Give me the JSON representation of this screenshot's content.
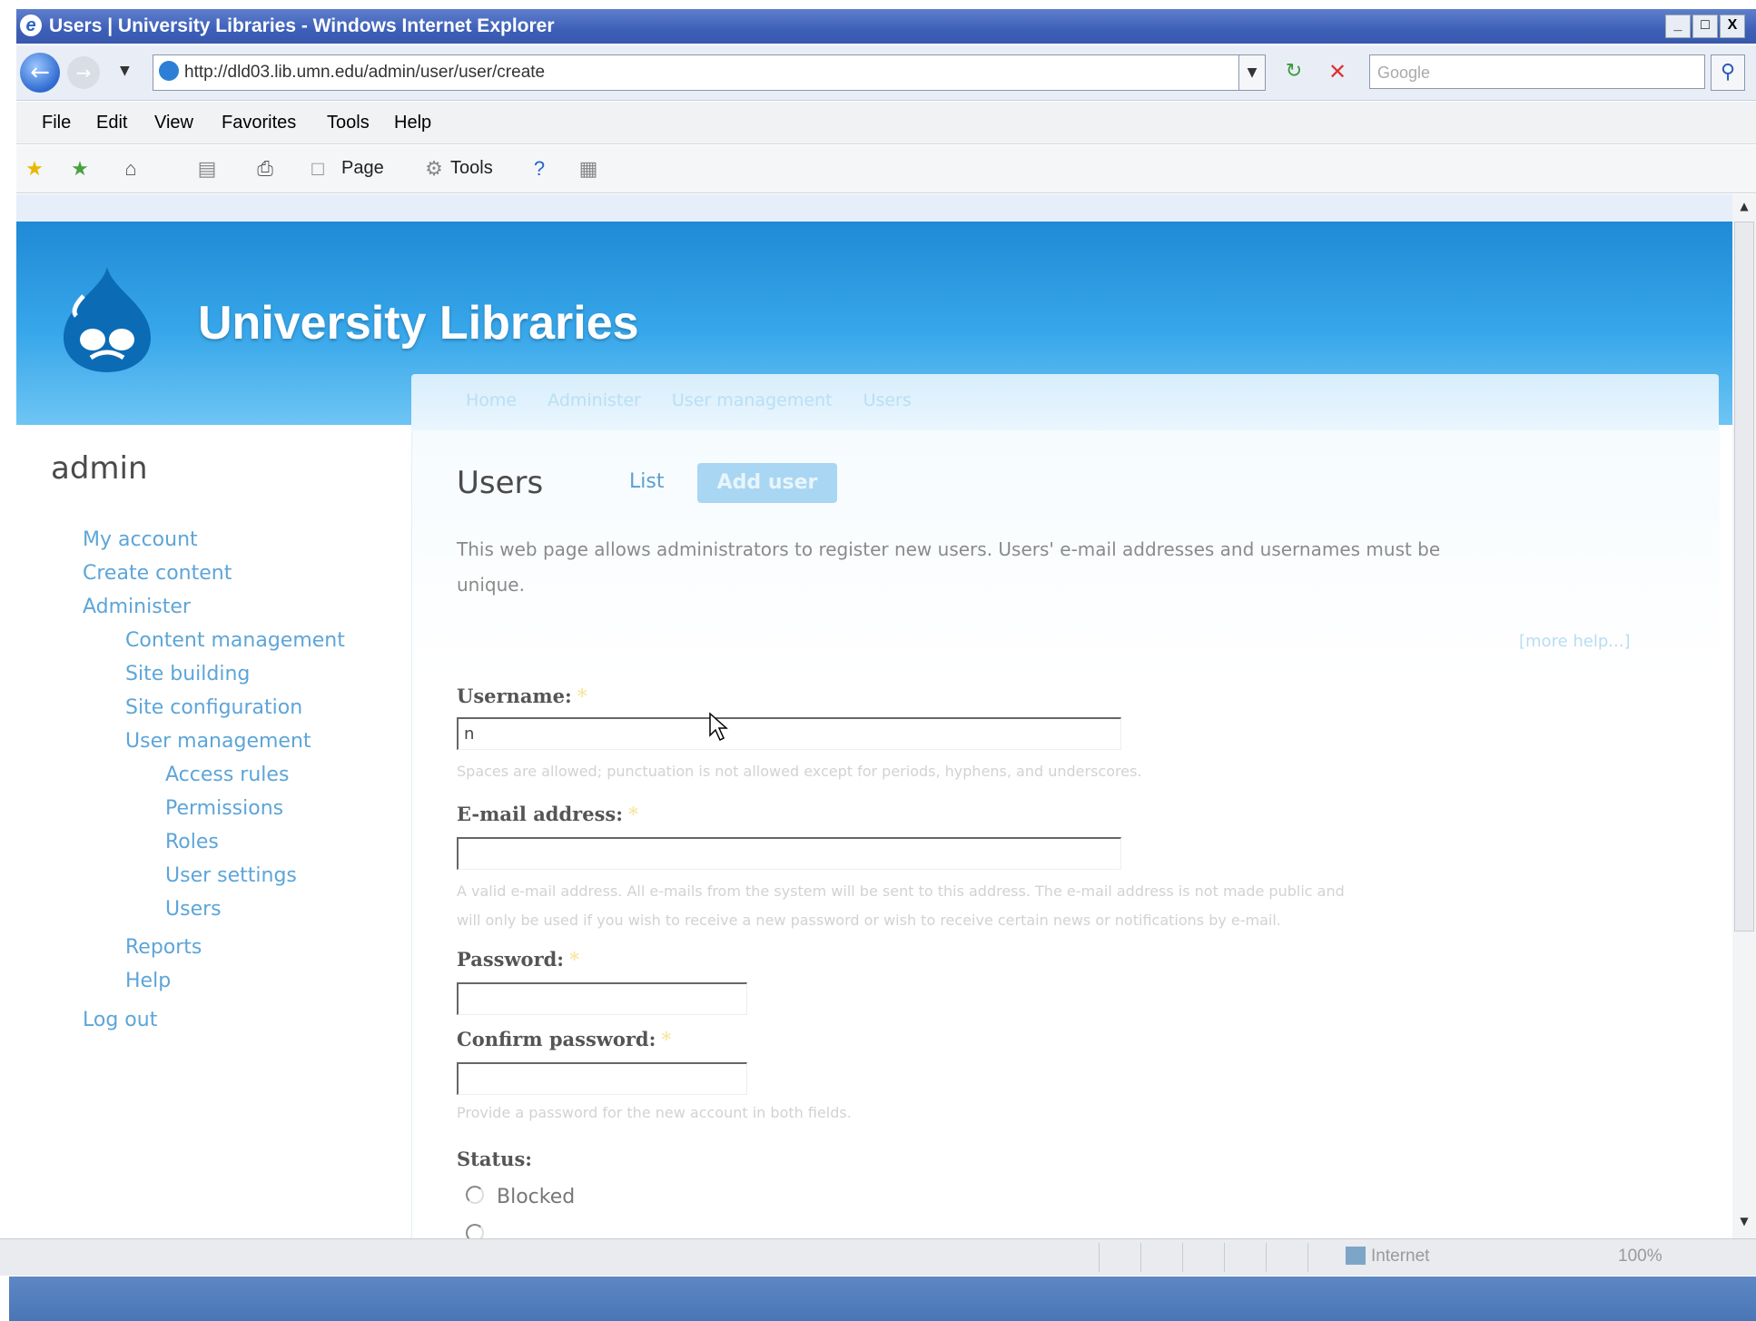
{
  "window": {
    "title": "Users | University Libraries - Windows Internet Explorer",
    "controls": {
      "minimize": "_",
      "maximize": "□",
      "close": "X"
    }
  },
  "addressbar": {
    "url": "http://dld03.lib.umn.edu/admin/user/user/create",
    "search_placeholder": "Google",
    "icons": [
      "back-icon",
      "forward-icon",
      "refresh-icon",
      "stop-icon",
      "search-icon"
    ]
  },
  "menubar": {
    "items": [
      "File",
      "Edit",
      "View",
      "Favorites",
      "Tools",
      "Help"
    ]
  },
  "favbar": {
    "page_label": "Page",
    "tools_label": "Tools"
  },
  "site": {
    "name": "University Libraries"
  },
  "breadcrumb": [
    "Home",
    "Administer",
    "User management",
    "Users"
  ],
  "sidebar": {
    "user": "admin",
    "items": [
      {
        "label": "My account",
        "level": 1
      },
      {
        "label": "Create content",
        "level": 1
      },
      {
        "label": "Administer",
        "level": 1
      },
      {
        "label": "Content management",
        "level": 2
      },
      {
        "label": "Site building",
        "level": 2
      },
      {
        "label": "Site configuration",
        "level": 2
      },
      {
        "label": "User management",
        "level": 2
      },
      {
        "label": "Access rules",
        "level": 3
      },
      {
        "label": "Permissions",
        "level": 3
      },
      {
        "label": "Roles",
        "level": 3
      },
      {
        "label": "User settings",
        "level": 3
      },
      {
        "label": "Users",
        "level": 3
      },
      {
        "label": "Reports",
        "level": 2
      },
      {
        "label": "Help",
        "level": 2
      },
      {
        "label": "Log out",
        "level": 1
      }
    ]
  },
  "main": {
    "title": "Users",
    "tabs": {
      "list": "List",
      "add": "Add user"
    },
    "intro_line1": "This web page allows administrators to register new users. Users' e-mail addresses and usernames must be",
    "intro_line2": "unique.",
    "more_help": "[more help...]",
    "username": {
      "label": "Username:",
      "value": "n",
      "description": "Spaces are allowed; punctuation is not allowed except for periods, hyphens, and underscores."
    },
    "email": {
      "label": "E-mail address:",
      "value": "",
      "description_line1": "A valid e-mail address. All e-mails from the system will be sent to this address. The e-mail address is not made public and",
      "description_line2": "will only be used if you wish to receive a new password or wish to receive certain news or notifications by e-mail."
    },
    "password": {
      "label": "Password:",
      "value": ""
    },
    "confirm_password": {
      "label": "Confirm password:",
      "value": "",
      "description": "Provide a password for the new account in both fields."
    },
    "status": {
      "label": "Status:",
      "options": [
        "Blocked"
      ]
    },
    "required_mark": "*"
  },
  "statusbar": {
    "zone": "Internet",
    "zoom": "100%"
  },
  "colors": {
    "header_blue": "#2a95de",
    "link_blue": "#5da5d8",
    "titlebar": "#3d5fb8",
    "taskbar": "#4a76b6"
  }
}
